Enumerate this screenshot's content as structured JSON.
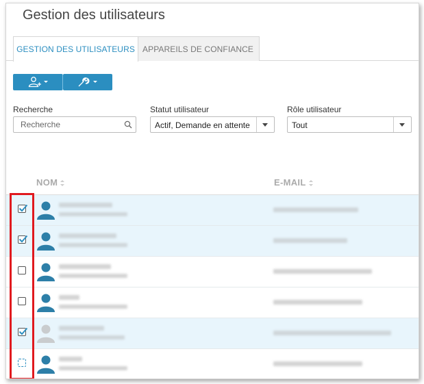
{
  "page": {
    "title": "Gestion des utilisateurs"
  },
  "tabs": [
    {
      "label": "GESTION DES UTILISATEURS",
      "active": true
    },
    {
      "label": "APPAREILS DE CONFIANCE",
      "active": false
    }
  ],
  "toolbar": {
    "add_user_icon": "add-user-icon",
    "settings_icon": "wrench-icon"
  },
  "filters": {
    "search": {
      "label": "Recherche",
      "placeholder": "Recherche",
      "value": ""
    },
    "status": {
      "label": "Statut utilisateur",
      "value": "Actif, Demande en attente"
    },
    "role": {
      "label": "Rôle utilisateur",
      "value": "Tout"
    }
  },
  "table": {
    "columns": [
      "NOM",
      "E-MAIL"
    ],
    "rows": [
      {
        "checked": true,
        "name": "",
        "email": ""
      },
      {
        "checked": true,
        "name": "",
        "email": ""
      },
      {
        "checked": false,
        "name": "",
        "email": ""
      },
      {
        "checked": false,
        "name": "",
        "email": ""
      },
      {
        "checked": true,
        "name": "",
        "email": ""
      },
      {
        "checked": false,
        "name": "",
        "email": ""
      }
    ]
  },
  "colors": {
    "accent": "#2b8ec0",
    "selected_row": "#e8f5fc",
    "highlight_border": "#e0191e"
  }
}
